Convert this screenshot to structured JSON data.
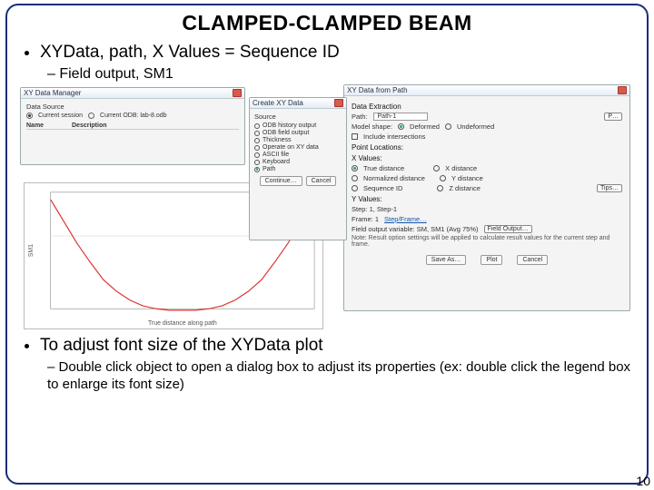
{
  "title": "CLAMPED-CLAMPED BEAM",
  "bullet1": "XYData, path, X Values = Sequence ID",
  "sub1": "Field output, SM1",
  "mgr": {
    "title": "XY Data Manager",
    "ds_label": "Data Source",
    "ds_opt1": "Current session",
    "ds_opt2": "Current ODB: lab-8.odb",
    "col1": "Name",
    "col2": "Description"
  },
  "create": {
    "title": "Create XY Data",
    "src_label": "Source",
    "opts": [
      "ODB history output",
      "ODB field output",
      "Thickness",
      "Operate on XY data",
      "ASCII file",
      "Keyboard",
      "Path"
    ],
    "continue": "Continue…",
    "cancel": "Cancel"
  },
  "path": {
    "title": "XY Data from Path",
    "data_extraction": "Data Extraction",
    "path_label": "Path:",
    "path_value": "Path-1",
    "pbtn": "P…",
    "model_shape": "Model shape:",
    "deformed": "Deformed",
    "undeformed": "Undeformed",
    "include_intersections": "Include intersections",
    "point_locations": "Point Locations:",
    "xvalues": "X Values:",
    "xopts": [
      "True distance",
      "X distance",
      "Normalized distance",
      "Y distance",
      "Sequence ID",
      "Z distance"
    ],
    "tips": "Tips…",
    "yvalues": "Y Values:",
    "step_label": "Step:  1, Step-1",
    "frame_label": "Frame: 1",
    "stepframe": "Step/Frame…",
    "fieldout_label": "Field output variable: SM, SM1 (Avg 75%)",
    "fieldout_btn": "Field Output…",
    "note": "Note: Result option settings will be applied to calculate result values for the current step and frame.",
    "save_as": "Save As…",
    "plot": "Plot",
    "cancel": "Cancel"
  },
  "chart_data": {
    "type": "line",
    "xlabel": "True distance along path",
    "ylabel": "SM1",
    "xlim": [
      0,
      3
    ],
    "ylim": [
      -0.05,
      0.03
    ],
    "x": [
      0.0,
      0.15,
      0.3,
      0.45,
      0.6,
      0.75,
      0.9,
      1.05,
      1.2,
      1.35,
      1.5,
      1.65,
      1.8,
      1.95,
      2.1,
      2.25,
      2.4,
      2.55,
      2.7,
      2.85,
      3.0
    ],
    "y": [
      0.025,
      0.01,
      -0.005,
      -0.018,
      -0.03,
      -0.038,
      -0.044,
      -0.048,
      -0.05,
      -0.051,
      -0.051,
      -0.051,
      -0.05,
      -0.048,
      -0.044,
      -0.038,
      -0.03,
      -0.018,
      -0.005,
      0.01,
      0.025
    ]
  },
  "bullet2": "To adjust font size of the XYData plot",
  "sub2": "Double click object to open a dialog box to adjust its properties (ex: double click the legend box to enlarge its font size)",
  "page": "10"
}
